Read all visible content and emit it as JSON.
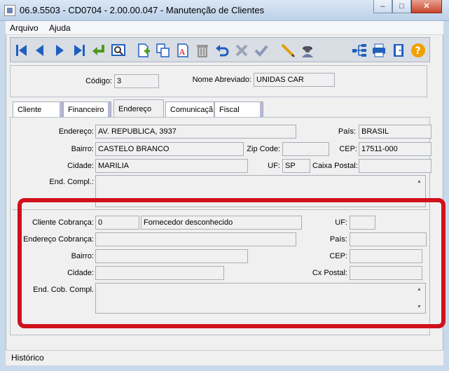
{
  "window": {
    "title": "06.9.5503 - CD0704 - 2.00.00.047 - Manutenção de Clientes",
    "minimize": "–",
    "maximize": "□",
    "close": "✕"
  },
  "menu": {
    "items": [
      "Arquivo",
      "Ajuda"
    ]
  },
  "toolbar": {
    "icons": [
      "first-record-icon",
      "previous-record-icon",
      "next-record-icon",
      "last-record-icon",
      "goto-icon",
      "search-icon",
      "new-icon",
      "copy-icon",
      "edit-icon",
      "delete-icon",
      "undo-icon",
      "cancel-icon",
      "save-icon",
      "edit-pencil-icon",
      "user-query-icon",
      "tree-icon",
      "print-icon",
      "exit-icon",
      "help-icon"
    ]
  },
  "header": {
    "codigo_label": "Código:",
    "codigo_value": "3",
    "nome_label": "Nome Abreviado:",
    "nome_value": "UNIDAS CAR"
  },
  "tabs": [
    {
      "label": "Cliente",
      "active": false
    },
    {
      "label": "Financeiro",
      "active": false
    },
    {
      "label": "Endereço",
      "active": true
    },
    {
      "label": "Comunicaçã",
      "active": false
    },
    {
      "label": "Fiscal",
      "active": false
    }
  ],
  "endereco": {
    "endereco_label": "Endereço:",
    "endereco_value": "AV. REPUBLICA, 3937",
    "pais_label": "País:",
    "pais_value": "BRASIL",
    "bairro_label": "Bairro:",
    "bairro_value": "CASTELO BRANCO",
    "zip_label": "Zip Code:",
    "zip_value": "",
    "cep_label": "CEP:",
    "cep_value": "17511-000",
    "cidade_label": "Cidade:",
    "cidade_value": "MARILIA",
    "uf_label": "UF:",
    "uf_value": "SP",
    "caixa_label": "Caixa Postal:",
    "caixa_value": "",
    "compl_label": "End. Compl.:",
    "compl_value": ""
  },
  "cobranca": {
    "cliente_label": "Cliente Cobrança:",
    "cliente_code": "0",
    "cliente_name": "Fornecedor desconhecido",
    "uf_label": "UF:",
    "uf_value": "",
    "endereco_label": "Endereço Cobrança:",
    "endereco_value": "",
    "pais_label": "País:",
    "pais_value": "",
    "bairro_label": "Bairro:",
    "bairro_value": "",
    "cep_label": "CEP:",
    "cep_value": "",
    "cidade_label": "Cidade:",
    "cidade_value": "",
    "cx_label": "Cx Postal:",
    "cx_value": "",
    "compl_label": "End. Cob. Compl.",
    "compl_value": ""
  },
  "status": {
    "text": "Histórico"
  },
  "colors": {
    "highlight": "#d0111b",
    "toolbar_icon": "#1f5fbf"
  }
}
